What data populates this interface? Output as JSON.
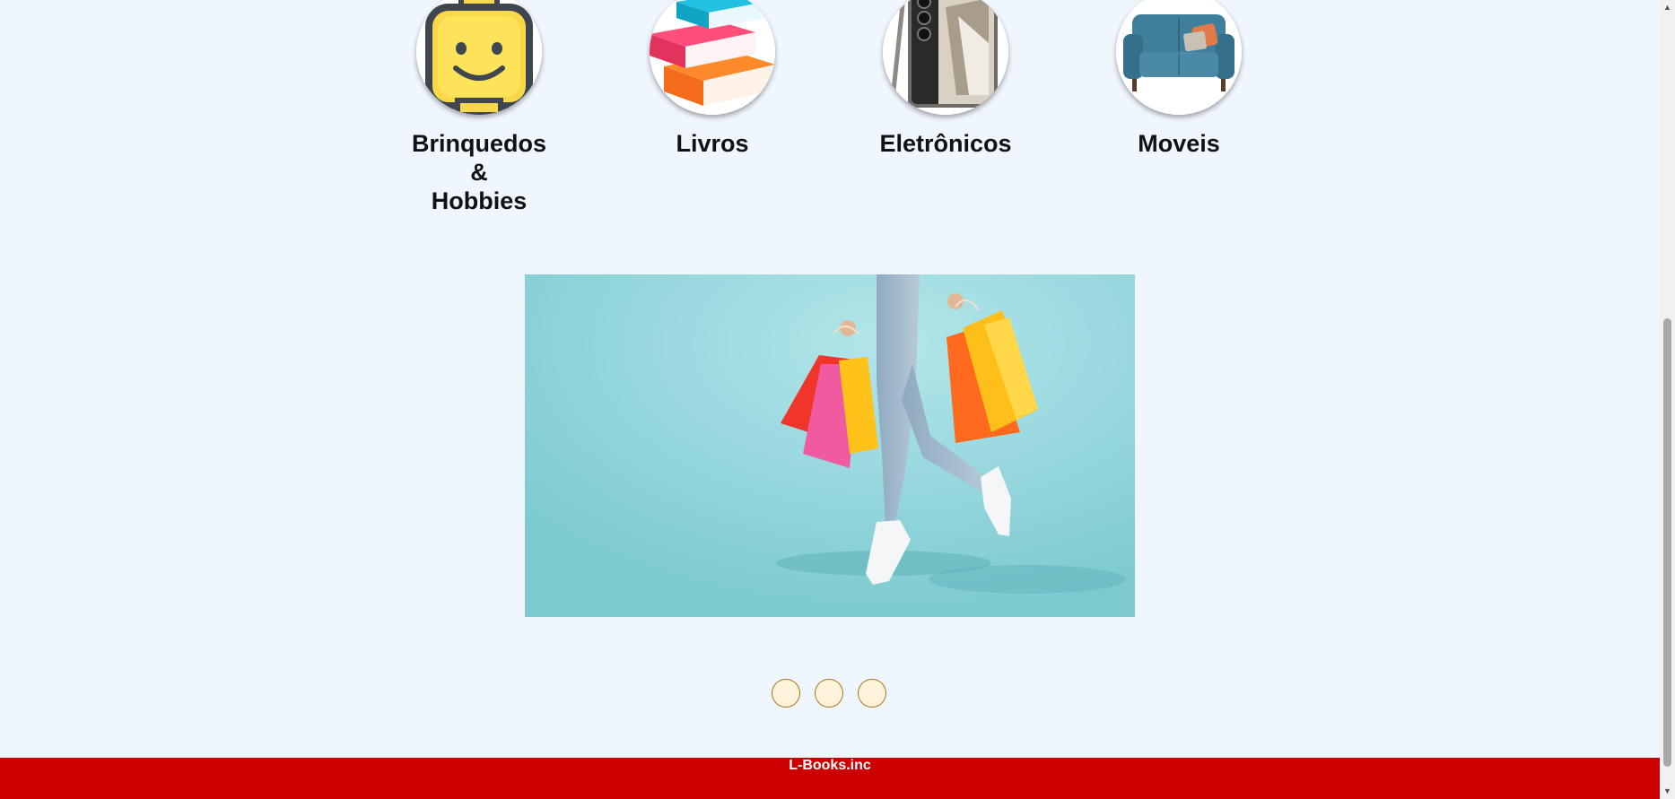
{
  "categories": [
    {
      "label_lines": [
        "Brinquedos",
        "&",
        "Hobbies"
      ],
      "icon": "toy-face-icon"
    },
    {
      "label_lines": [
        "Livros"
      ],
      "icon": "books-icon"
    },
    {
      "label_lines": [
        "Eletrônicos"
      ],
      "icon": "smartphone-icon"
    },
    {
      "label_lines": [
        "Moveis"
      ],
      "icon": "sofa-icon"
    }
  ],
  "banner": {
    "icon": "shopping-banner-image"
  },
  "carousel": {
    "dots": 3
  },
  "footer": {
    "text": "L-Books.inc"
  },
  "scrollbar": {
    "up_icon": "▲",
    "down_icon": "▼"
  },
  "colors": {
    "page_background": "#eff6fd",
    "footer_background": "#cc0000",
    "footer_text": "#ffffff",
    "dot_fill": "#fff3dc",
    "dot_border": "#a07a1c"
  }
}
